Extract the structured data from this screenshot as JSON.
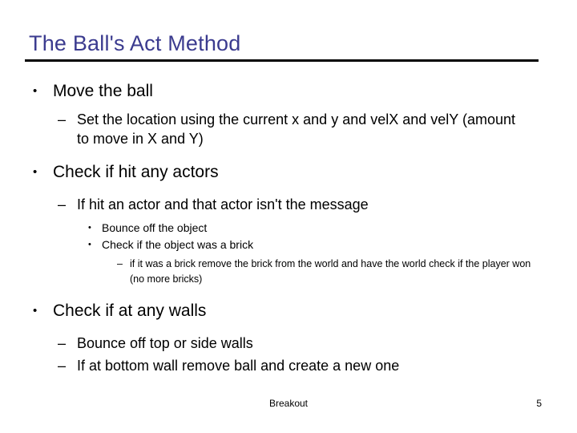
{
  "slide": {
    "title": "The Ball's Act Method",
    "title_color": "#3b3b8f",
    "rule_color": "#000000",
    "background_color": "#ffffff",
    "text_color": "#000000"
  },
  "bullets": {
    "marks": {
      "disc": "•",
      "dash": "–"
    },
    "l1_move": "Move the ball",
    "l2_move_detail": "Set the location using the current x and y and velX and velY (amount to move in X and Y)",
    "l1_actors": "Check if hit any actors",
    "l2_actors_detail": "If hit an actor and that actor isn't the message",
    "l3_bounce": "Bounce off the object",
    "l3_brick": "Check if the object was a brick",
    "l4_brick_detail": "if it was a brick remove the brick from the world and have the world check if the player won (no more bricks)",
    "l1_walls": "Check if at any walls",
    "l2_walls_bounce": "Bounce off top or side walls",
    "l2_walls_bottom": "If at bottom wall remove ball and create a new one"
  },
  "footer": {
    "label": "Breakout",
    "page_number": "5"
  }
}
